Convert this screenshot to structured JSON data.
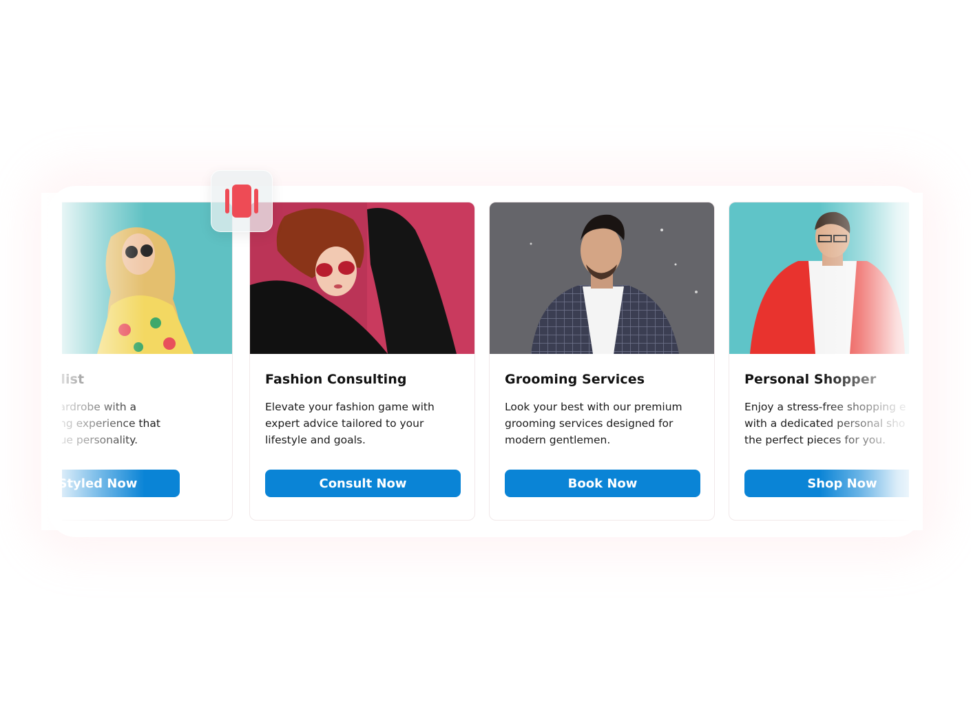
{
  "carousel": {
    "cards": [
      {
        "title": "nal Stylist",
        "description": "m your wardrobe with a lized styling experience that your unique personality.",
        "desc_lines": [
          "m your wardrobe with a",
          "lized styling experience that",
          "your unique personality."
        ],
        "button": "Get Styled Now"
      },
      {
        "title": "Fashion Consulting",
        "desc_lines": [
          "Elevate your fashion game with",
          "expert advice tailored to your",
          "lifestyle and goals."
        ],
        "button": "Consult Now"
      },
      {
        "title": "Grooming Services",
        "desc_lines": [
          "Look your best with our premium",
          "grooming services designed for",
          "modern gentlemen."
        ],
        "button": "Book Now"
      },
      {
        "title": "Personal Shopper",
        "desc_lines": [
          "Enjoy a stress-free shopping e",
          "with a dedicated personal sho",
          "the perfect pieces for you."
        ],
        "button": "Shop Now"
      }
    ],
    "drag_handle_icon": "carousel-drag-icon"
  },
  "colors": {
    "button": "#0a84d6",
    "handle_icon": "#ee4b55",
    "card_border": "#f1e8e9"
  }
}
